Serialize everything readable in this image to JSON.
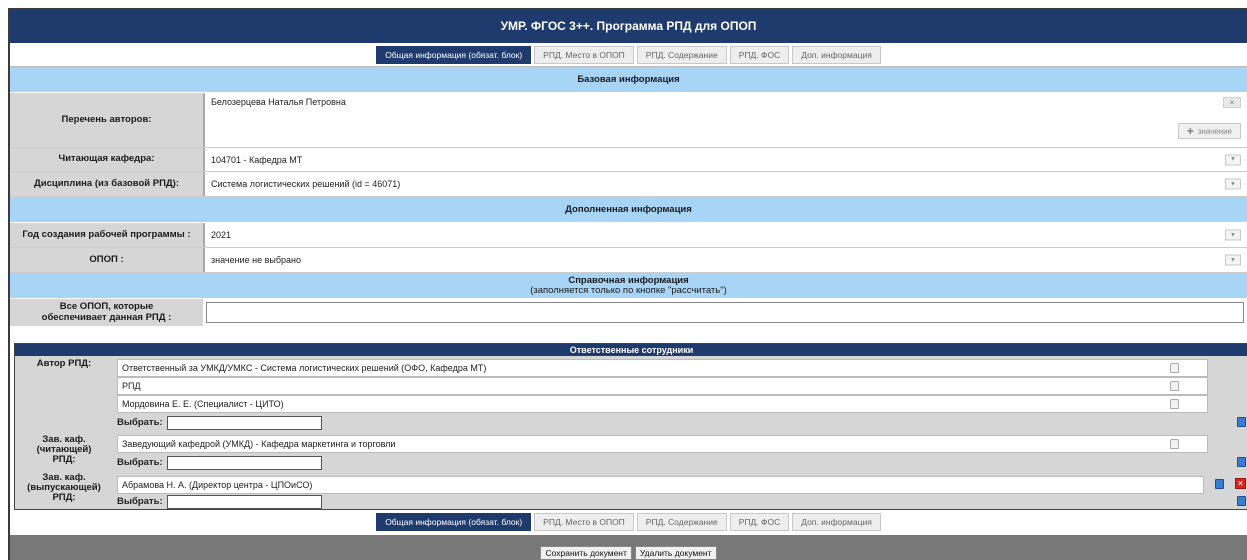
{
  "title": "УМР. ФГОС 3++. Программа РПД для ОПОП",
  "tabs": [
    "Общая информация (обязат. блок)",
    "РПД. Место в ОПОП",
    "РПД. Содержание",
    "РПД. ФОС",
    "Доп. информация"
  ],
  "active_tab": 0,
  "sections": {
    "basic": "Базовая информация",
    "extra": "Дополненная информация",
    "ref_title": "Справочная информация",
    "ref_subtitle": "(заполняется только по кнопке \"рассчитать\")"
  },
  "fields": {
    "authors_label": "Перечень авторов:",
    "authors_value": "Белозерцева Наталья Петровна",
    "add_value_label": "значение",
    "dept_label": "Читающая кафедра:",
    "dept_value": "104701 - Кафедра МТ",
    "discipline_label": "Дисциплина (из базовой РПД):",
    "discipline_value": "Система логистических решений (id = 46071)",
    "year_label": "Год создания рабочей программы :",
    "year_value": "2021",
    "opop_label": "ОПОП :",
    "opop_value": "значение не выбрано",
    "all_opop_label_1": "Все ОПОП, которые",
    "all_opop_label_2": "обеспечивает данная РПД :",
    "all_opop_value": ""
  },
  "responsible": {
    "header": "Ответственные сотрудники",
    "author_label": "Автор РПД:",
    "author_rows": [
      "Ответственный за УМКД/УМКС - Система логистических решений (ОФО, Кафедра МТ)",
      "РПД",
      "Мордовина Е. Е. (Специалист - ЦИТО)"
    ],
    "select_label": "Выбрать:",
    "head_reading_label_1": "Зав. каф.",
    "head_reading_label_2": "(читающей)",
    "head_reading_label_3": "РПД:",
    "head_reading_rows": [
      "Заведующий кафедрой (УМКД) - Кафедра маркетинга и торговли"
    ],
    "head_graduating_label_1": "Зав. каф.",
    "head_graduating_label_2": "(выпускающей)",
    "head_graduating_label_3": "РПД:",
    "head_graduating_rows": [
      "Абрамова Н. А. (Директор центра - ЦПОиСО)"
    ]
  },
  "footer": {
    "save": "Сохранить документ",
    "delete": "Удалить документ"
  },
  "icons": {
    "remove": "×",
    "add": "✚",
    "dropdown": "▼"
  },
  "colors": {
    "header_bg": "#1f3b6e",
    "section_bg": "#a8d4f5",
    "label_bg": "#d6d6d6",
    "footer_bg": "#787878"
  }
}
